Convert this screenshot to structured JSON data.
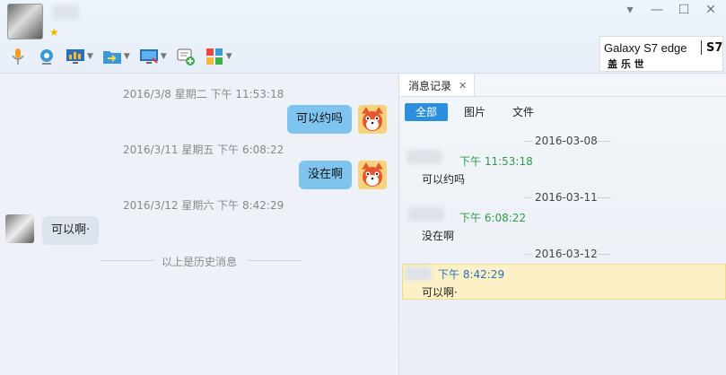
{
  "header": {
    "window_controls": [
      "▾",
      "—",
      "☐",
      "✕"
    ]
  },
  "toolbar": {
    "icons": [
      "microphone-icon",
      "video-icon",
      "screen-share-icon",
      "folder-transfer-icon",
      "remote-desktop-icon",
      "message-add-icon",
      "apps-icon"
    ]
  },
  "ad": {
    "line1": "Galaxy S7 edge",
    "line2": "盖 乐 世",
    "s7": "S7"
  },
  "chat": {
    "messages": [
      {
        "timestamp": "2016/3/8 星期二 下午 11:53:18",
        "text": "可以约吗",
        "from": "me"
      },
      {
        "timestamp": "2016/3/11 星期五 下午 6:08:22",
        "text": "没在啊",
        "from": "me"
      },
      {
        "timestamp": "2016/3/12 星期六 下午 8:42:29",
        "text": "可以啊·",
        "from": "them"
      }
    ],
    "history_label": "以上是历史消息"
  },
  "history_panel": {
    "tab_label": "消息记录",
    "tab_close": "✕",
    "filters": [
      "全部",
      "图片",
      "文件"
    ],
    "entries": [
      {
        "date": "2016-03-08",
        "time": "下午 11:53:18",
        "text": "可以约吗"
      },
      {
        "date": "2016-03-11",
        "time": "下午 6:08:22",
        "text": "没在啊"
      },
      {
        "date": "2016-03-12",
        "time": "下午 8:42:29",
        "text": "可以啊·"
      }
    ]
  },
  "colors": {
    "accent": "#2c8fdd",
    "my_bubble": "#7fc4ee",
    "time_green": "#2e9a4a",
    "time_blue": "#2a6fc0",
    "highlight": "#fcf1c6"
  }
}
